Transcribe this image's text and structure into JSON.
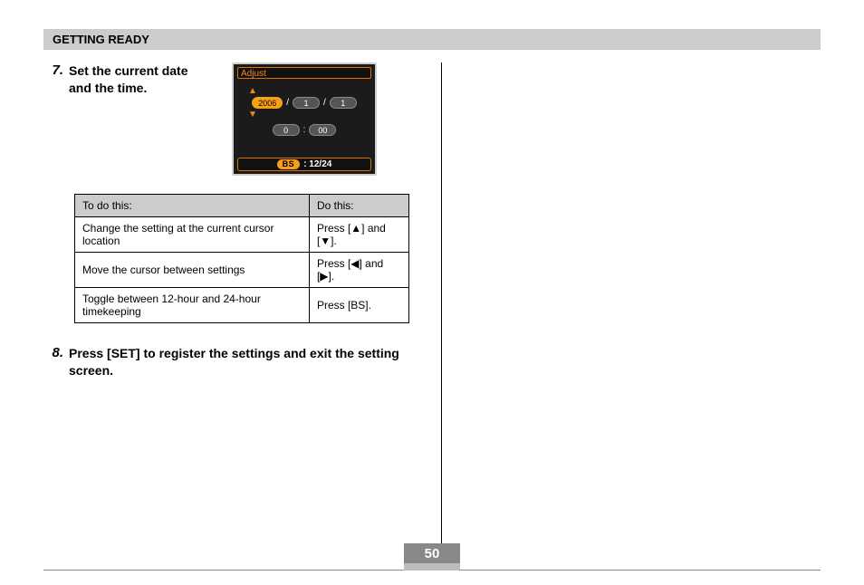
{
  "header": {
    "title": "GETTING READY"
  },
  "steps": {
    "s7": {
      "num": "7.",
      "text": "Set the current date and the time."
    },
    "s8": {
      "num": "8.",
      "text": "Press [SET] to register the settings and exit the setting screen."
    }
  },
  "lcd": {
    "title": "Adjust",
    "date": {
      "y": "2006",
      "m": "1",
      "d": "1"
    },
    "time": {
      "h": "0",
      "min": "00"
    },
    "separators": {
      "slash": "/",
      "colon": ":"
    },
    "bs": {
      "label": "BS",
      "value": ": 12/24"
    }
  },
  "table": {
    "head": {
      "c1": "To do this:",
      "c2": "Do this:"
    },
    "rows": [
      {
        "c1": "Change the setting at the current cursor location",
        "c2": "Press [▲] and [▼]."
      },
      {
        "c1": "Move the cursor between settings",
        "c2": "Press [◀] and [▶]."
      },
      {
        "c1": "Toggle between 12-hour and 24-hour timekeeping",
        "c2": "Press [BS]."
      }
    ]
  },
  "footer": {
    "page": "50"
  }
}
